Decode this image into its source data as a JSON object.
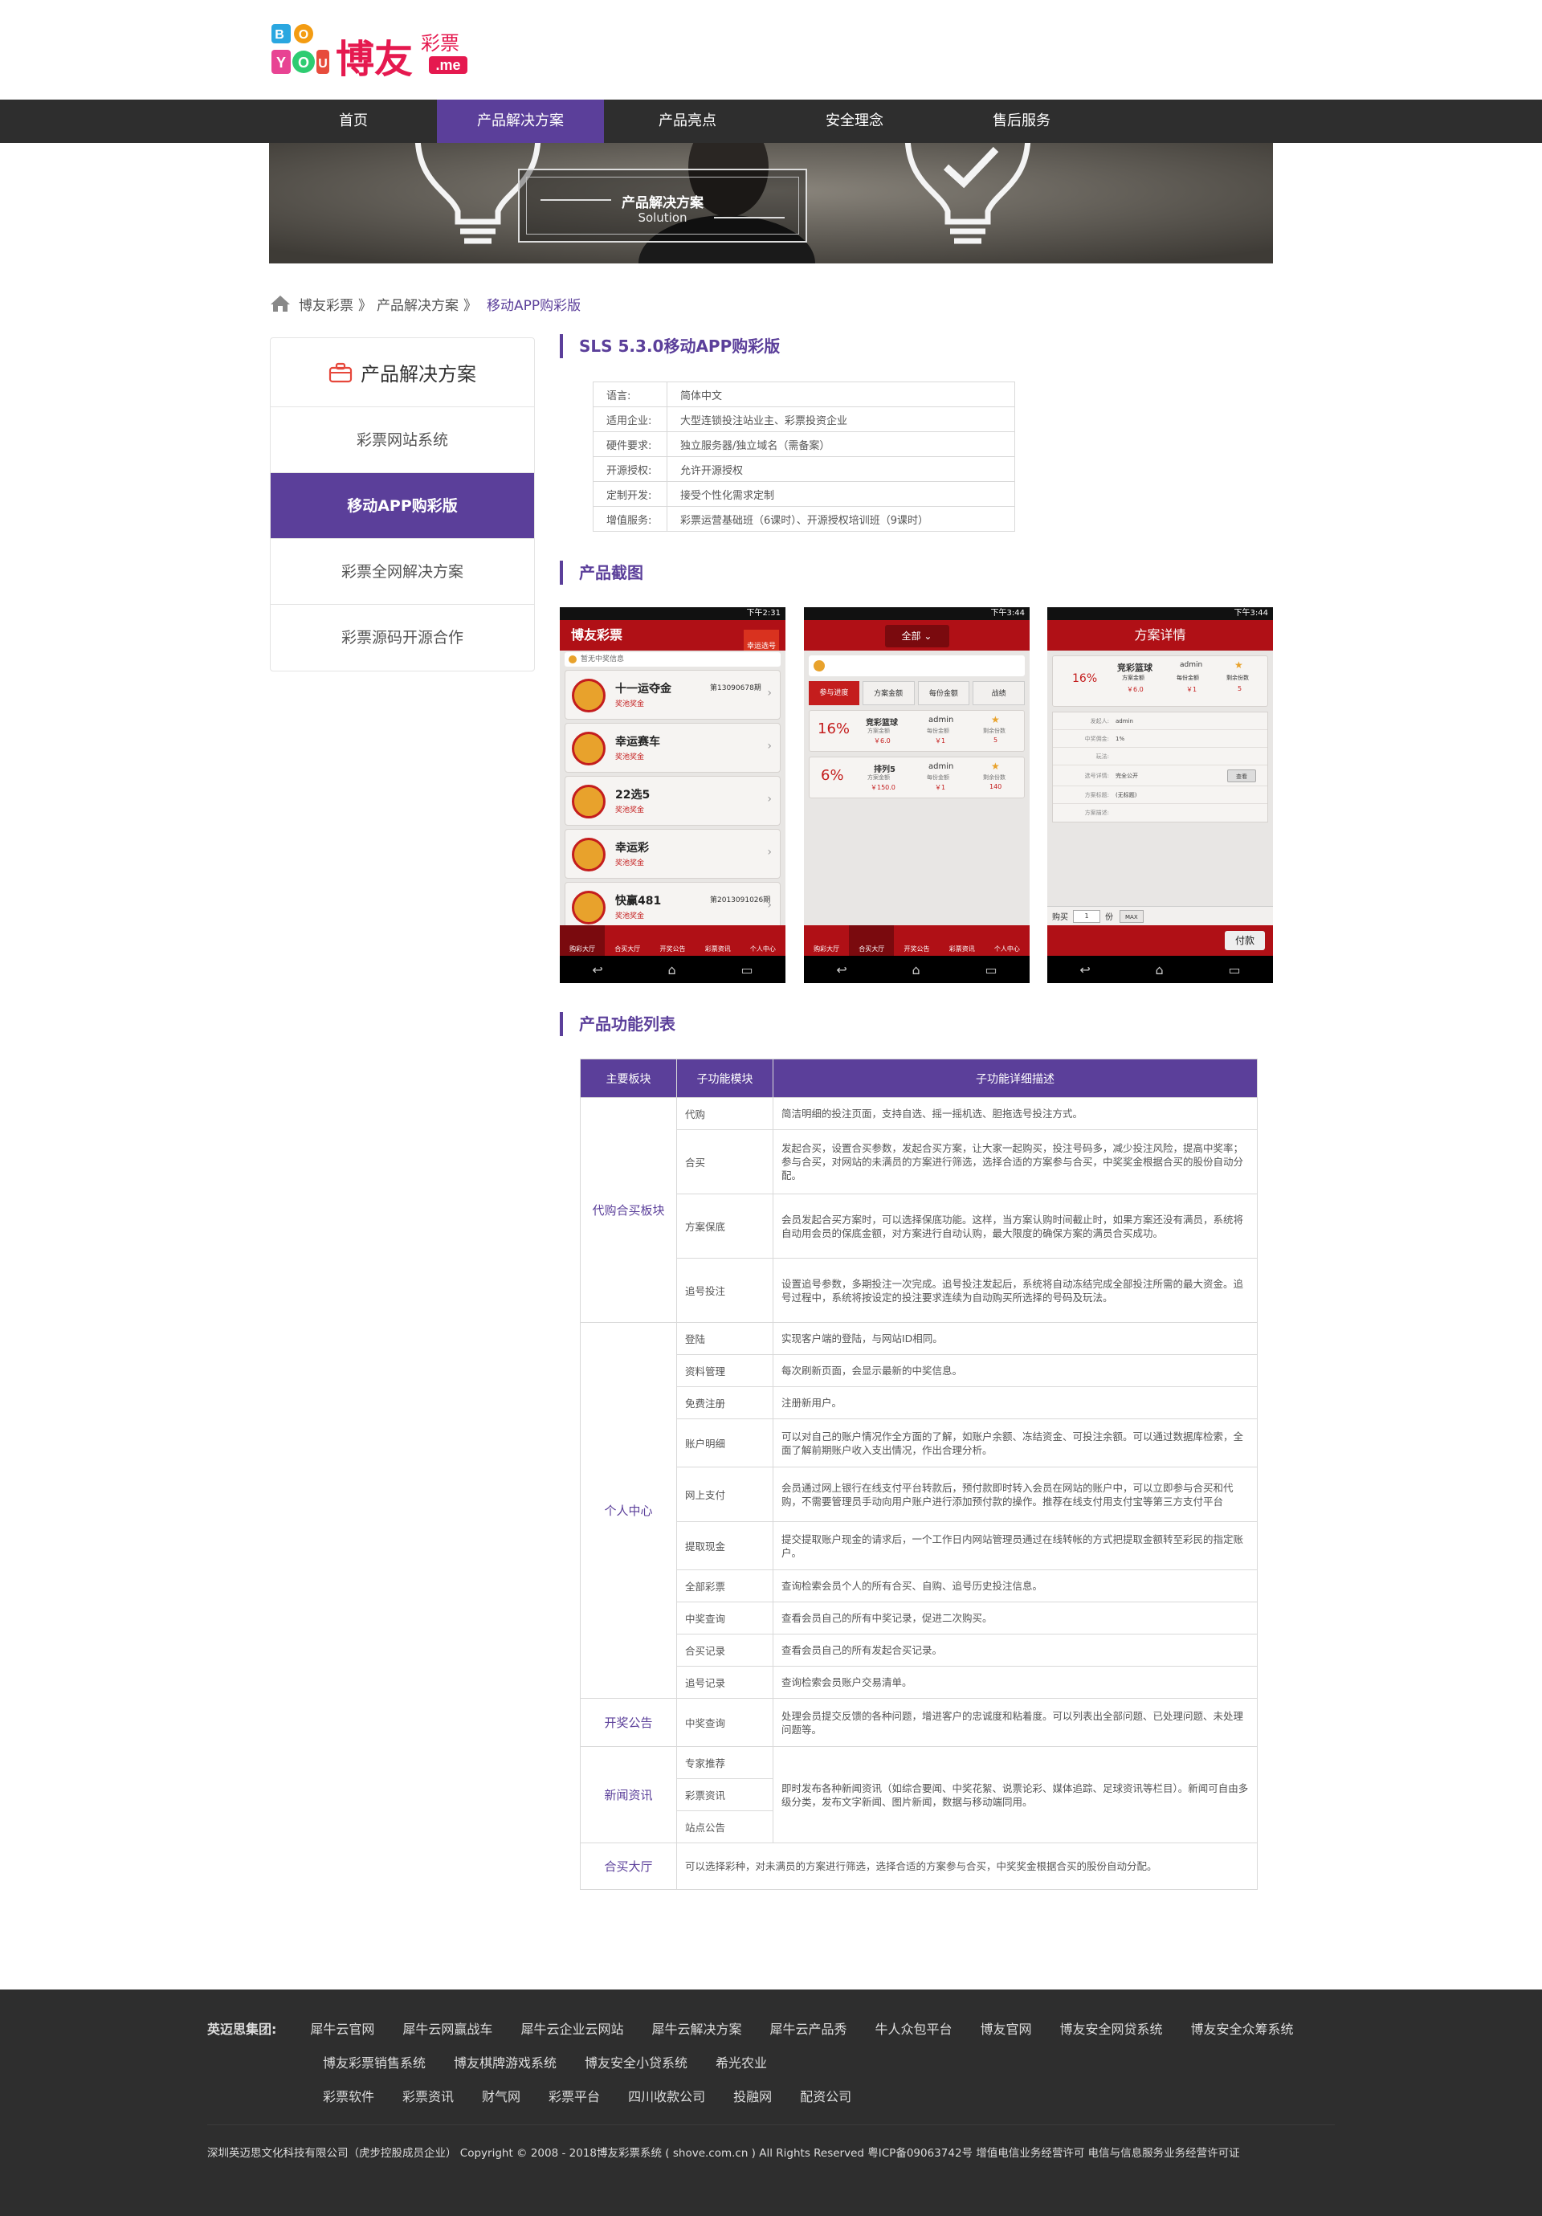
{
  "logo": {
    "main": "博友",
    "sub": "彩票",
    "domain": ".me",
    "letters": "BOYOU"
  },
  "nav": [
    "首页",
    "产品解决方案",
    "产品亮点",
    "安全理念",
    "售后服务"
  ],
  "banner": {
    "title": "产品解决方案",
    "subtitle": "Solution"
  },
  "breadcrumb": {
    "home": "博友彩票",
    "sep": "》",
    "level1": "产品解决方案",
    "current": "移动APP购彩版"
  },
  "sidebar": {
    "title": "产品解决方案",
    "items": [
      "彩票网站系统",
      "移动APP购彩版",
      "彩票全网解决方案",
      "彩票源码开源合作"
    ]
  },
  "sections": {
    "product": "SLS 5.3.0移动APP购彩版",
    "screens": "产品截图",
    "features": "产品功能列表"
  },
  "info": [
    {
      "k": "语言:",
      "v": "简体中文"
    },
    {
      "k": "适用企业:",
      "v": "大型连锁投注站业主、彩票投资企业"
    },
    {
      "k": "硬件要求:",
      "v": "独立服务器/独立域名（需备案）"
    },
    {
      "k": "开源授权:",
      "v": "允许开源授权"
    },
    {
      "k": "定制开发:",
      "v": "接受个性化需求定制"
    },
    {
      "k": "增值服务:",
      "v": "彩票运营基础班（6课时）、开源授权培训班（9课时）"
    }
  ],
  "phones": {
    "p1": {
      "time": "下午2:31",
      "title": "博友彩票",
      "badge": "幸运选号",
      "notice": "暂无中奖信息",
      "items": [
        {
          "name": "十一运夺金",
          "sub": "奖池奖金",
          "no": "第13090678期"
        },
        {
          "name": "幸运赛车",
          "sub": "奖池奖金",
          "no": ""
        },
        {
          "name": "22选5",
          "sub": "奖池奖金",
          "no": ""
        },
        {
          "name": "幸运彩",
          "sub": "奖池奖金",
          "no": ""
        },
        {
          "name": "快赢481",
          "sub": "奖池奖金",
          "no": "第2013091026期"
        }
      ],
      "tabs": [
        "购彩大厅",
        "合买大厅",
        "开奖公告",
        "彩票资讯",
        "个人中心"
      ]
    },
    "p2": {
      "time": "下午3:44",
      "filter": "全部",
      "tabs": [
        "参与进度",
        "方案金额",
        "每份金额",
        "战绩"
      ],
      "cards": [
        {
          "pct": "16%",
          "game": "竞彩篮球",
          "amt": "￥6.0",
          "user": "admin",
          "per": "￥1",
          "left": "5",
          "l1": "方案金额",
          "l2": "每份金额",
          "l3": "剩余份数"
        },
        {
          "pct": "6%",
          "game": "排列5",
          "amt": "￥150.0",
          "user": "admin",
          "per": "￥1",
          "left": "140",
          "l1": "方案金额",
          "l2": "每份金额",
          "l3": "剩余份数"
        }
      ],
      "bottom": [
        "购彩大厅",
        "合买大厅",
        "开奖公告",
        "彩票资讯",
        "个人中心"
      ]
    },
    "p3": {
      "time": "下午3:44",
      "title": "方案详情",
      "pct": "16%",
      "game": "竞彩篮球",
      "user": "admin",
      "l1": "方案金额",
      "l2": "每份金额",
      "l3": "剩余份数",
      "amt": "￥6.0",
      "per": "￥1",
      "left": "5",
      "rows": [
        {
          "k": "发起人:",
          "v": "admin"
        },
        {
          "k": "中奖佣金:",
          "v": "1%"
        },
        {
          "k": "玩法:",
          "v": ""
        },
        {
          "k": "选号详情:",
          "v": "完全公开"
        },
        {
          "k": "方案标题:",
          "v": "(无标题)"
        },
        {
          "k": "方案描述:",
          "v": ""
        }
      ],
      "view": "查看",
      "buy": "购买",
      "qty": "1",
      "unit": "份",
      "max": "MAX",
      "pay": "付款"
    }
  },
  "feature_table": {
    "headers": [
      "主要板块",
      "子功能模块",
      "子功能详细描述"
    ],
    "groups": [
      {
        "name": "代购合买板块",
        "rows": [
          {
            "sub": "代购",
            "desc": "简洁明细的投注页面，支持自选、摇一摇机选、胆拖选号投注方式。"
          },
          {
            "sub": "合买",
            "desc": "发起合买，设置合买参数，发起合买方案，让大家一起购买，投注号码多，减少投注风险，提高中奖率；参与合买，对网站的未满员的方案进行筛选，选择合适的方案参与合买，中奖奖金根据合买的股份自动分配。"
          },
          {
            "sub": "方案保底",
            "desc": "会员发起合买方案时，可以选择保底功能。这样，当方案认购时间截止时，如果方案还没有满员，系统将自动用会员的保底金额，对方案进行自动认购，最大限度的确保方案的满员合买成功。"
          },
          {
            "sub": "追号投注",
            "desc": "设置追号参数，多期投注一次完成。追号投注发起后，系统将自动冻结完成全部投注所需的最大资金。追号过程中，系统将按设定的投注要求连续为自动购买所选择的号码及玩法。"
          }
        ]
      },
      {
        "name": "个人中心",
        "rows": [
          {
            "sub": "登陆",
            "desc": "实现客户端的登陆，与网站ID相同。"
          },
          {
            "sub": "资料管理",
            "desc": "每次刷新页面，会显示最新的中奖信息。"
          },
          {
            "sub": "免费注册",
            "desc": "注册新用户。"
          },
          {
            "sub": "账户明细",
            "desc": "可以对自己的账户情况作全方面的了解，如账户余额、冻结资金、可投注余额。可以通过数据库检索，全面了解前期账户收入支出情况，作出合理分析。"
          },
          {
            "sub": "网上支付",
            "desc": "会员通过网上银行在线支付平台转款后，预付款即时转入会员在网站的账户中，可以立即参与合买和代购，不需要管理员手动向用户账户进行添加预付款的操作。推荐在线支付用支付宝等第三方支付平台"
          },
          {
            "sub": "提取现金",
            "desc": "提交提取账户现金的请求后，一个工作日内网站管理员通过在线转帐的方式把提取金额转至彩民的指定账户。"
          },
          {
            "sub": "全部彩票",
            "desc": "查询检索会员个人的所有合买、自购、追号历史投注信息。"
          },
          {
            "sub": "中奖查询",
            "desc": "查看会员自己的所有中奖记录，促进二次购买。"
          },
          {
            "sub": "合买记录",
            "desc": "查看会员自己的所有发起合买记录。"
          },
          {
            "sub": "追号记录",
            "desc": "查询检索会员账户交易清单。"
          }
        ]
      },
      {
        "name": "开奖公告",
        "rows": [
          {
            "sub": "中奖查询",
            "desc": "处理会员提交反馈的各种问题，增进客户的忠诚度和粘着度。可以列表出全部问题、已处理问题、未处理问题等。"
          }
        ]
      }
    ],
    "news": {
      "name": "新闻资讯",
      "subs": [
        "专家推荐",
        "彩票资讯",
        "站点公告"
      ],
      "desc": "即时发布各种新闻资讯（如综合要闻、中奖花絮、说票论彩、媒体追踪、足球资讯等栏目）。新闻可自由多级分类，发布文字新闻、图片新闻，数据与移动端同用。"
    },
    "hall": {
      "name": "合买大厅",
      "desc": "可以选择彩种，对未满员的方案进行筛选，选择合适的方案参与合买，中奖奖金根据合买的股份自动分配。"
    }
  },
  "footer": {
    "group_label": "英迈思集团:",
    "row1": [
      "犀牛云官网",
      "犀牛云网赢战车",
      "犀牛云企业云网站",
      "犀牛云解决方案",
      "犀牛云产品秀",
      "牛人众包平台",
      "博友官网",
      "博友安全网贷系统",
      "博友安全众筹系统"
    ],
    "row2": [
      "博友彩票销售系统",
      "博友棋牌游戏系统",
      "博友安全小贷系统",
      "希光农业"
    ],
    "row3": [
      "彩票软件",
      "彩票资讯",
      "财气网",
      "彩票平台",
      "四川收款公司",
      "投融网",
      "配资公司"
    ],
    "copyright": "深圳英迈思文化科技有限公司（虎步控股成员企业）   Copyright © 2008 - 2018博友彩票系统 ( shove.com.cn ) All Rights Reserved 粤ICP备09063742号  增值电信业务经营许可  电信与信息服务业务经营许可证"
  },
  "colors": {
    "accent": "#5b3f9a",
    "nav_bg": "#2e2e2e",
    "app_red": "#b01016"
  }
}
